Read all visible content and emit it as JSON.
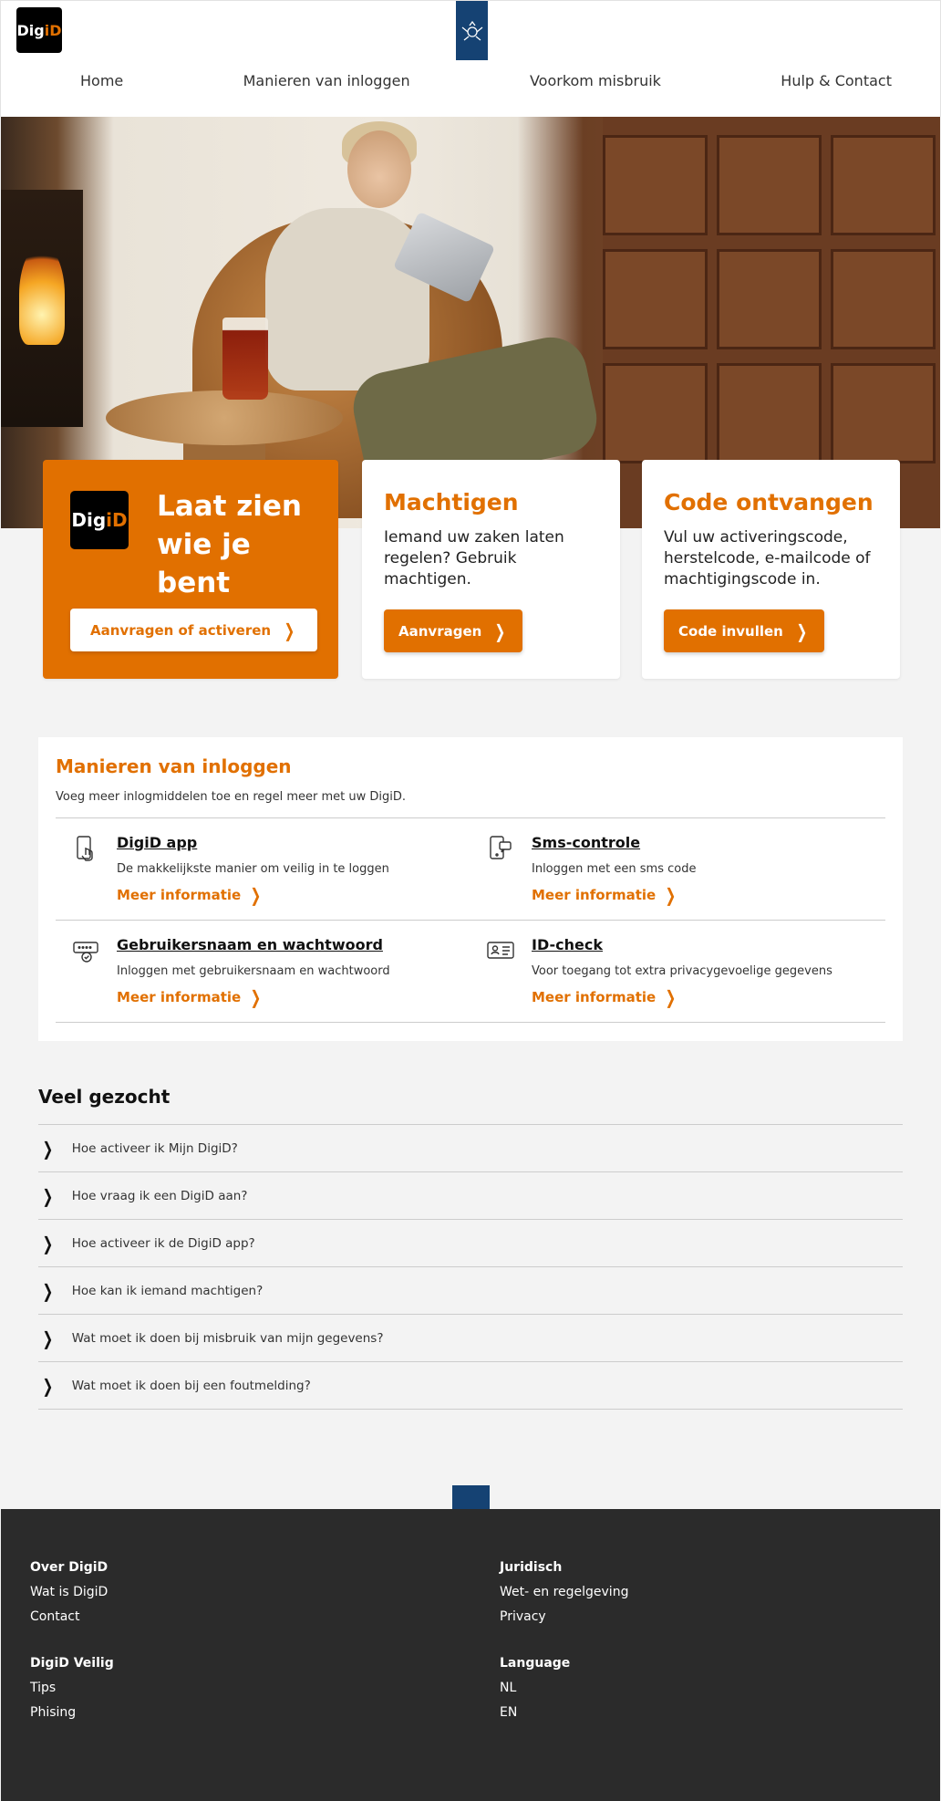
{
  "header": {
    "logo_text_a": "Dig",
    "logo_text_b": "iD",
    "nav": [
      "Home",
      "Manieren van inloggen",
      "Voorkom misbruik",
      "Hulp & Contact"
    ]
  },
  "cards": {
    "main": {
      "logo_a": "Dig",
      "logo_b": "iD",
      "title": "Laat zien wie je bent",
      "button": "Aanvragen of activeren"
    },
    "machtigen": {
      "title": "Machtigen",
      "text": "Iemand uw zaken laten regelen? Gebruik machtigen.",
      "button": "Aanvragen"
    },
    "code": {
      "title": "Code ontvangen",
      "text": "Vul uw activeringscode, herstelcode, e-mailcode of machtigingscode in.",
      "button": "Code invullen"
    }
  },
  "ways": {
    "title": "Manieren van inloggen",
    "subtitle": "Voeg meer inlogmiddelen toe en regel meer met uw DigiD.",
    "more_label": "Meer informatie",
    "items": [
      {
        "title": "DigiD app",
        "desc": "De makkelijkste manier om veilig in te loggen",
        "icon": "phone-tap-icon"
      },
      {
        "title": "Sms-controle",
        "desc": "Inloggen met een sms code",
        "icon": "phone-message-icon"
      },
      {
        "title": "Gebruikersnaam en wachtwoord",
        "desc": "Inloggen met gebruikersnaam en wachtwoord",
        "icon": "password-icon"
      },
      {
        "title": "ID-check",
        "desc": "Voor toegang tot extra privacygevoelige gegevens",
        "icon": "id-card-icon"
      }
    ]
  },
  "faq": {
    "title": "Veel gezocht",
    "items": [
      "Hoe activeer ik Mijn DigiD?",
      "Hoe vraag ik een DigiD aan?",
      "Hoe activeer ik de DigiD app?",
      "Hoe kan ik iemand machtigen?",
      "Wat moet ik doen bij misbruik van mijn gegevens?",
      "Wat moet ik doen bij een foutmelding?"
    ]
  },
  "footer": {
    "over": {
      "title": "Over DigiD",
      "links": [
        "Wat is DigiD",
        "Contact"
      ]
    },
    "juridisch": {
      "title": "Juridisch",
      "links": [
        "Wet- en regelgeving",
        "Privacy"
      ]
    },
    "veilig": {
      "title": "DigiD Veilig",
      "links": [
        "Tips",
        "Phising"
      ]
    },
    "language": {
      "title": "Language",
      "links": [
        "NL",
        "EN"
      ]
    }
  },
  "colors": {
    "accent": "#e17000",
    "rijksblauw": "#154273",
    "footer": "#2b2b2b"
  }
}
